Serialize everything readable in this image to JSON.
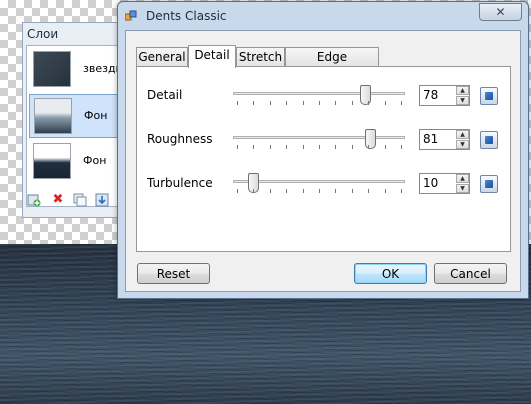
{
  "layers_panel": {
    "title": "Слои",
    "layers": [
      {
        "name": "звезды"
      },
      {
        "name": "Фон"
      },
      {
        "name": "Фон"
      }
    ]
  },
  "dialog": {
    "title": "Dents Classic",
    "close_symbol": "✕",
    "tabs": [
      "General",
      "Detail",
      "Stretch",
      "Edge Behaviour"
    ],
    "active_tab": "Detail",
    "params": [
      {
        "label": "Detail",
        "value": "78"
      },
      {
        "label": "Roughness",
        "value": "81"
      },
      {
        "label": "Turbulence",
        "value": "10"
      }
    ],
    "buttons": {
      "reset": "Reset",
      "ok": "OK",
      "cancel": "Cancel"
    }
  },
  "colors": {
    "dialog_frame": "#c9d9ec",
    "selection": "#cfe3fb",
    "delete_icon": "#d4262a"
  },
  "icons": {
    "spin_up": "▲",
    "spin_down": "▼",
    "delete": "✖"
  }
}
